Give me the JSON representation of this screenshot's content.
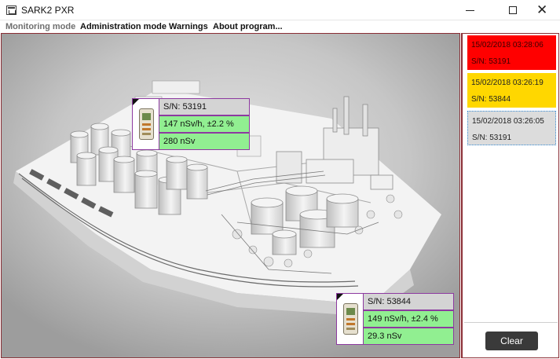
{
  "window": {
    "title": "SARK2 PXR",
    "minimize_icon": "minimize-icon",
    "maximize_icon": "maximize-icon",
    "close_glyph": "✕"
  },
  "menu": {
    "items": [
      {
        "label": "Monitoring mode",
        "active": true
      },
      {
        "label": "Administration mode",
        "active": false
      },
      {
        "label": "Warnings",
        "active": false
      },
      {
        "label": "About program...",
        "active": false
      }
    ]
  },
  "map": {
    "description_icon": "industrial-plant-3d-view",
    "devices": [
      {
        "sn": "S/N: 53191",
        "rate": "147 nSv/h, ±2.2 %",
        "dose": "280 nSv",
        "status_color": "#91ef91"
      },
      {
        "sn": "S/N: 53844",
        "rate": "149 nSv/h, ±2.4 %",
        "dose": "29.3 nSv",
        "status_color": "#91ef91"
      }
    ]
  },
  "events": [
    {
      "timestamp": "15/02/2018 03:28:06",
      "sn": "S/N: 53191",
      "level": "alarm",
      "color": "#ff0000"
    },
    {
      "timestamp": "15/02/2018 03:26:19",
      "sn": "S/N: 53844",
      "level": "warning",
      "color": "#ffd700"
    },
    {
      "timestamp": "15/02/2018 03:26:05",
      "sn": "S/N: 53191",
      "level": "normal",
      "color": "#dcdcdc"
    }
  ],
  "panel": {
    "clear_label": "Clear"
  },
  "colors": {
    "frame_border": "#8a2d34",
    "card_border": "#8d3aa0",
    "ok_green": "#91ef91"
  }
}
